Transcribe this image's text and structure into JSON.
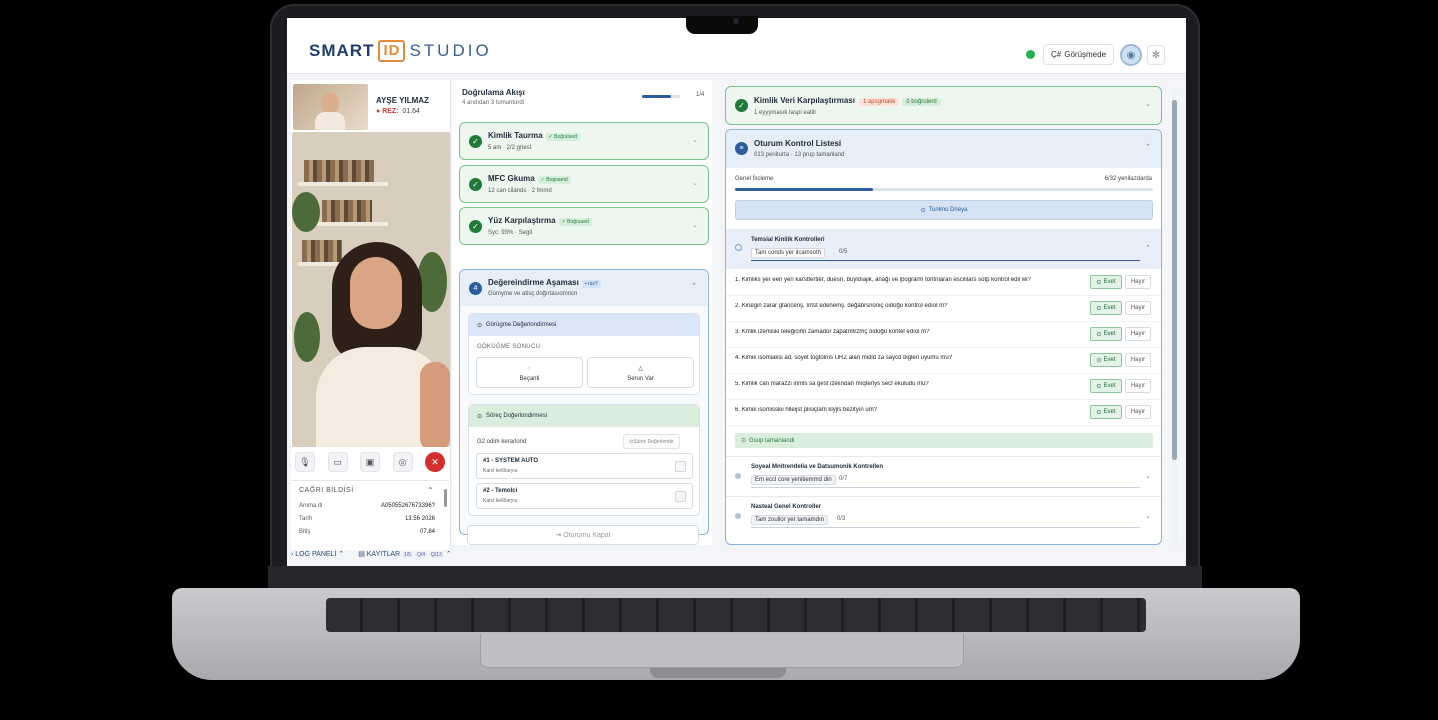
{
  "header": {
    "logo_smart": "SMART",
    "logo_id": "ID",
    "logo_studio": "STUDIO",
    "status_label": "Görüşmede",
    "status_prefix": "Ç#",
    "avatar_icon": "user-icon",
    "settings_icon": "gear-icon"
  },
  "caller": {
    "name": "AYŞE YILMAZ",
    "ref_label": "REZ:",
    "ref_value": "01.64"
  },
  "controls": [
    "mic-icon",
    "video-icon",
    "screen-share-icon",
    "camera-icon",
    "end-call-icon"
  ],
  "call_info": {
    "title": "CAĞRI BİLDİSİ",
    "rows": [
      {
        "label": "Anıma iti",
        "value": "A05055267673396?"
      },
      {
        "label": "Tarih",
        "value": "13.56 2026"
      },
      {
        "label": "Bitiş",
        "value": "07.84"
      }
    ]
  },
  "bottom_bar": {
    "log_panel": "LOG PANELİ",
    "kayitlar": "KAYITLAR",
    "badge1": "1/5",
    "badge2": "Q/4",
    "badge3": "Q/13"
  },
  "flow": {
    "title": "Doğrulama Akışı",
    "subtitle": "4 arıdıdan 3 tumuntordi",
    "progress_fraction": 0.75,
    "count": "1/4",
    "steps": [
      {
        "title": "Kimlik Taurma",
        "badge": "✓ Boğrulued",
        "sub": "5 am · 2/2 griest"
      },
      {
        "title": "MFC Gkuma",
        "badge": "✓ Bogoamd",
        "sub": "12 can cilands · 2 fmmd"
      },
      {
        "title": "Yüz Karpılaştırma",
        "badge": "✓ Boğruued",
        "sub": "Syc: 93% · Segil"
      }
    ],
    "eval": {
      "num": "4",
      "title": "Değereindirme Aşaması",
      "badge": "• rüz7",
      "sub": "Gomyme ve atisç doğırtasıomncn",
      "visual": {
        "head": "Görügme Değerlondirmesi",
        "result_label": "GÖKÜĞME SONUCU",
        "btn_ok": "Beçanti",
        "btn_issue": "Serun Var"
      },
      "process": {
        "head": "Söreç Doğerlondirmesi",
        "row_label": "G2 odim kerarlond",
        "reval_button": "Sürec Değerlende",
        "items": [
          {
            "title": "#1 - SYSTEM AUTO",
            "sub": "Karcl keßllaryıu"
          },
          {
            "title": "#2 - Temolci",
            "sub": "Karcl keßllaryıu"
          }
        ]
      },
      "close_button": "Oturumu Kapat"
    }
  },
  "kimlik": {
    "title": "Kimlik Veri Karpılaştırması",
    "warn_badge": "1 apsgmalık",
    "ok_badge": "ö boğrulerd",
    "sub": "1 eyyymasık taspi eatill"
  },
  "session": {
    "num": "≡",
    "title": "Oturum Kontrol Listesi",
    "sub": "013 peniturta · 13 prup tamanland",
    "general_label": "Genel İlıcleme",
    "general_value": "6/32 yenilazdarda",
    "general_fraction": 0.33,
    "button_label": "Tunkno Dneya",
    "tech": {
      "title": "Temsial Kinilik Kontrolleri",
      "pill": "Tam conds yer ilcamsoth",
      "count": "0/5"
    },
    "questions": [
      {
        "n": "1.",
        "text": "Kimliks yer een yeri karsttertler, duesrı, buyldıajik, anağı ve lpograrm tontnlaran escililars sotp kontrol edil wi?"
      },
      {
        "n": "2.",
        "text": "Kinegin zarar gtancenş, Intst edenemş, değabrsnoniç oidoğu kontrol edıol m?"
      },
      {
        "n": "3.",
        "text": "Kmlik izemiski teleğicihn zamador zapatmtrzmç oidoğu kontel edıol m?"
      },
      {
        "n": "4.",
        "text": "Kimik isomiaksi ad, soyet togtolnıs URZ alan midid za saycd bigleri uyumu mu?"
      },
      {
        "n": "5.",
        "text": "Kimlik can marazzi inmls sa gest izeiından mıqterlys secf ekuludu mu?"
      },
      {
        "n": "6.",
        "text": "Kimik isomisskii hlleijst plisiçlam klyjls bezityın um?"
      }
    ],
    "yes_label": "Evet",
    "no_label": "Hayır",
    "group_done": "Gsup tamaniandi",
    "sections": [
      {
        "title": "Soyeal Mnitrendelia ve Datsumonik Kontrellen",
        "pill": "Em eccl core yenitiemmd din",
        "count": "0/7"
      },
      {
        "title": "Nasteal Genel Kontroller",
        "pill": "Tam zoullor yer tamamdın",
        "count": "0/3"
      }
    ]
  }
}
